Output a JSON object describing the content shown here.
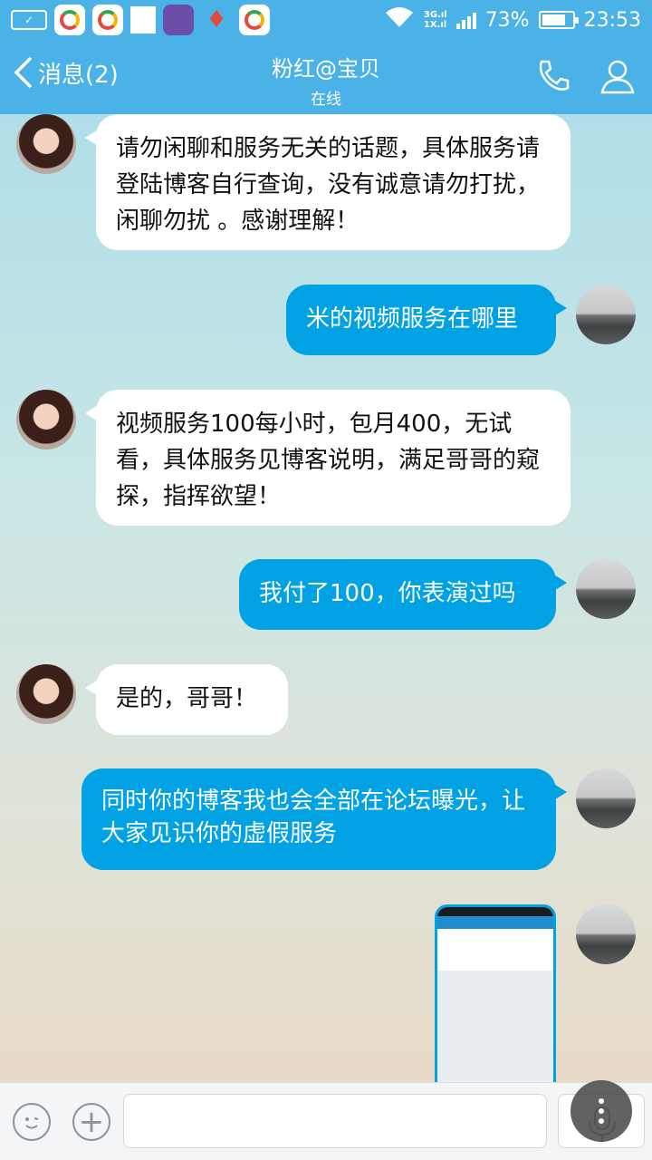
{
  "status_bar": {
    "net_3g": "3G.ıl",
    "net_1x": "1X.ıl",
    "battery": "73%",
    "time": "23:53"
  },
  "header": {
    "back_label": "消息(2)",
    "title": "粉红@宝贝",
    "subtitle": "在线",
    "accent_color": "#4ab2e6"
  },
  "messages": [
    {
      "from": "her",
      "text": "请勿闲聊和服务无关的话题，具体服务请登陆博客自行查询，没有诚意请勿打扰，闲聊勿扰 。感谢理解！"
    },
    {
      "from": "me",
      "text": "米的视频服务在哪里"
    },
    {
      "from": "her",
      "text": "视频服务100每小时，包月400，无试看，具体服务见博客说明，满足哥哥的窥探，指挥欲望！"
    },
    {
      "from": "me",
      "text": "我付了100，你表演过吗"
    },
    {
      "from": "her",
      "text": "是的，哥哥！"
    },
    {
      "from": "me",
      "text": "同时你的博客我也会全部在论坛曝光，让大家见识你的虚假服务"
    },
    {
      "from": "me",
      "type": "image",
      "text": ""
    }
  ],
  "bottom_bar": {
    "input_placeholder": ""
  }
}
